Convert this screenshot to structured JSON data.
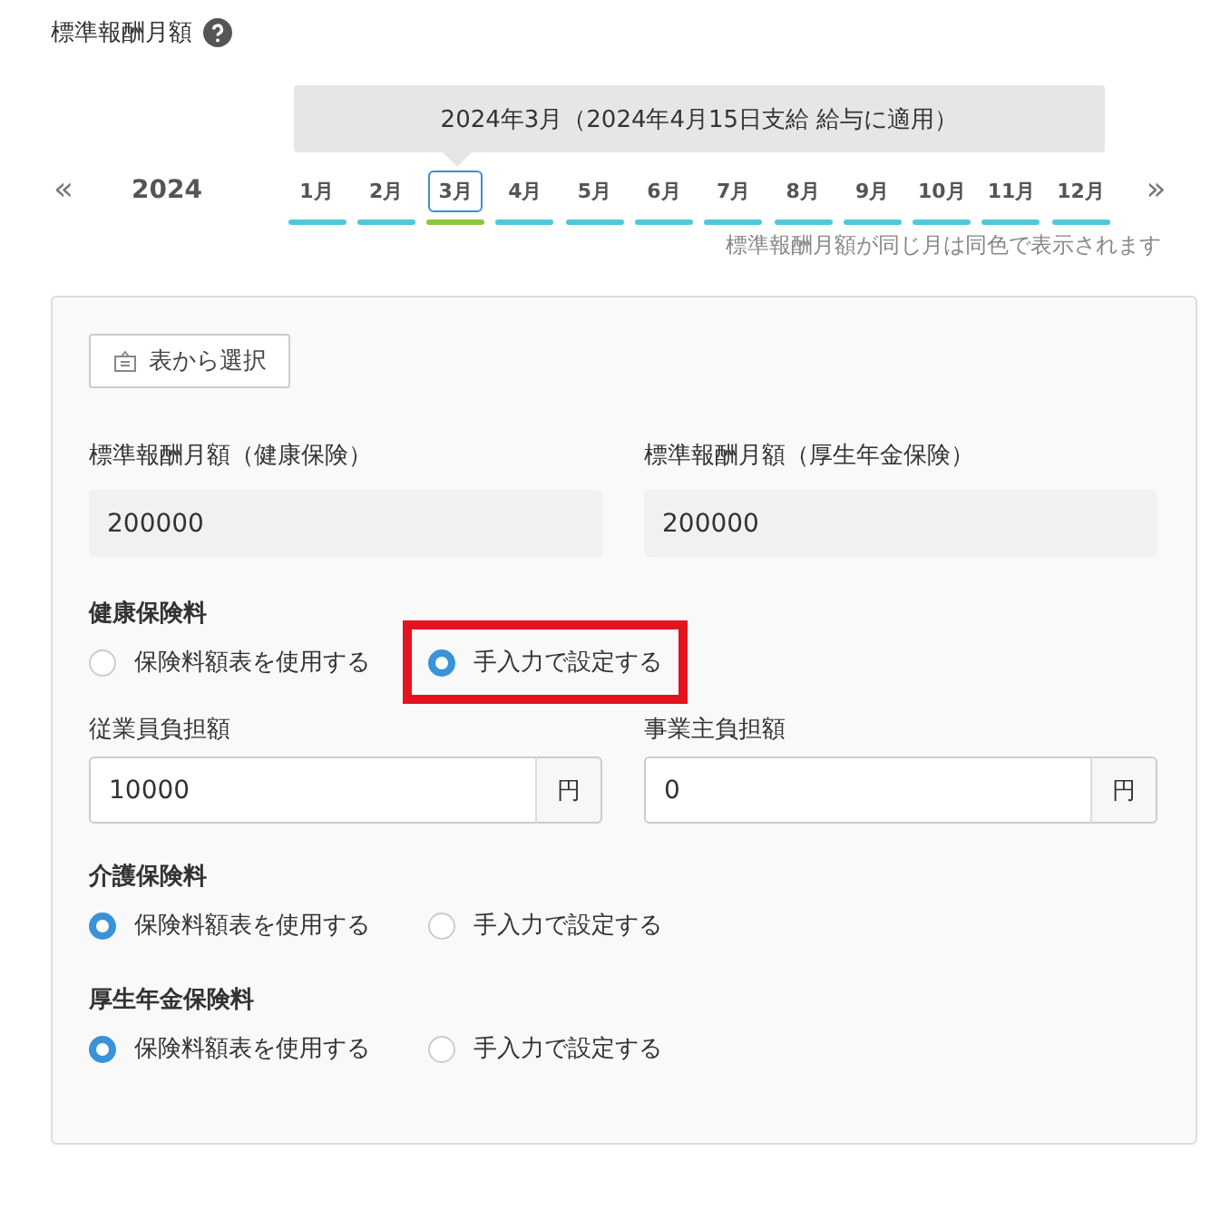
{
  "title": "標準報酬月額",
  "tooltip": "2024年3月（2024年4月15日支給 給与に適用）",
  "prev": "«",
  "year": "2024",
  "next": "»",
  "months": [
    {
      "label": "1月",
      "selected": false,
      "color": "#4ec9d9"
    },
    {
      "label": "2月",
      "selected": false,
      "color": "#4ec9d9"
    },
    {
      "label": "3月",
      "selected": true,
      "color": "#8cc63f"
    },
    {
      "label": "4月",
      "selected": false,
      "color": "#4ec9d9"
    },
    {
      "label": "5月",
      "selected": false,
      "color": "#4ec9d9"
    },
    {
      "label": "6月",
      "selected": false,
      "color": "#4ec9d9"
    },
    {
      "label": "7月",
      "selected": false,
      "color": "#4ec9d9"
    },
    {
      "label": "8月",
      "selected": false,
      "color": "#4ec9d9"
    },
    {
      "label": "9月",
      "selected": false,
      "color": "#4ec9d9"
    },
    {
      "label": "10月",
      "selected": false,
      "color": "#4ec9d9"
    },
    {
      "label": "11月",
      "selected": false,
      "color": "#4ec9d9"
    },
    {
      "label": "12月",
      "selected": false,
      "color": "#4ec9d9"
    }
  ],
  "note": "標準報酬月額が同じ月は同色で表示されます",
  "select_button": "表から選択",
  "readonly_fields": [
    {
      "label": "標準報酬月額（健康保険）",
      "value": "200000"
    },
    {
      "label": "標準報酬月額（厚生年金保険）",
      "value": "200000"
    }
  ],
  "sections": [
    {
      "label": "健康保険料",
      "options": [
        {
          "label": "保険料額表を使用する",
          "selected": false,
          "highlighted": false
        },
        {
          "label": "手入力で設定する",
          "selected": true,
          "highlighted": true
        }
      ],
      "inputs": [
        {
          "label": "従業員負担額",
          "value": "10000",
          "unit": "円"
        },
        {
          "label": "事業主負担額",
          "value": "0",
          "unit": "円"
        }
      ]
    },
    {
      "label": "介護保険料",
      "options": [
        {
          "label": "保険料額表を使用する",
          "selected": true,
          "highlighted": false
        },
        {
          "label": "手入力で設定する",
          "selected": false,
          "highlighted": false
        }
      ]
    },
    {
      "label": "厚生年金保険料",
      "options": [
        {
          "label": "保険料額表を使用する",
          "selected": true,
          "highlighted": false
        },
        {
          "label": "手入力で設定する",
          "selected": false,
          "highlighted": false
        }
      ]
    }
  ]
}
